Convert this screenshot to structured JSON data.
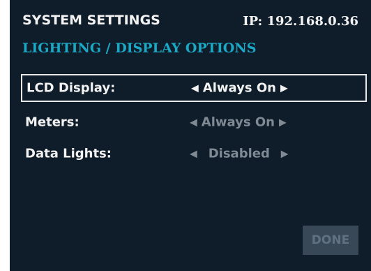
{
  "header": {
    "title": "SYSTEM SETTINGS",
    "ip": "IP: 192.168.0.36",
    "subtitle": "LIGHTING / DISPLAY OPTIONS"
  },
  "settings": [
    {
      "label": "LCD Display:",
      "value": "Always On",
      "state": "selected"
    },
    {
      "label": "Meters:",
      "value": "Always On",
      "state": "dim"
    },
    {
      "label": "Data Lights:",
      "value": "Disabled",
      "state": "dim"
    }
  ],
  "done_label": "DONE",
  "colors": {
    "background": "#0f1d2a",
    "accent": "#1aa8c4",
    "text": "#f2f2f2",
    "dim_text": "#7f8a94",
    "button_bg": "#384857"
  },
  "icons": {
    "left_arrow": "left-arrow-icon",
    "right_arrow": "right-arrow-icon"
  }
}
